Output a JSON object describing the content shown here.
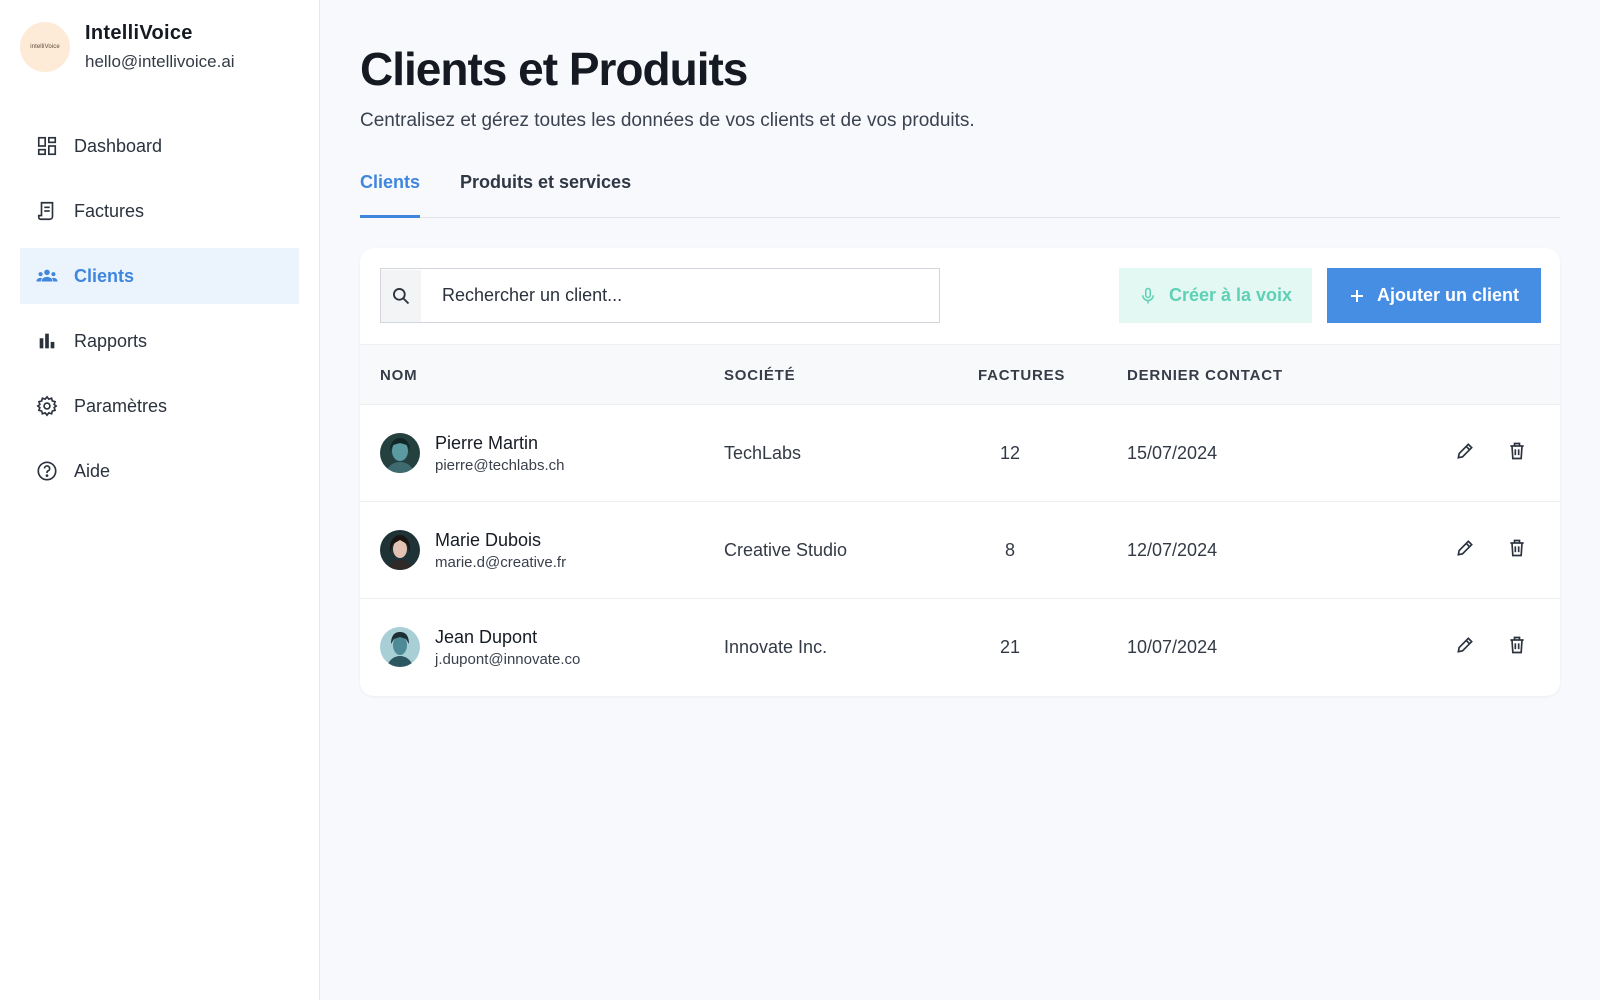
{
  "brand": {
    "name": "IntelliVoice",
    "email": "hello@intellivoice.ai",
    "logo_text": "intelliVoice"
  },
  "sidebar": {
    "items": [
      {
        "label": "Dashboard",
        "icon": "dashboard-icon",
        "active": false
      },
      {
        "label": "Factures",
        "icon": "invoice-icon",
        "active": false
      },
      {
        "label": "Clients",
        "icon": "people-icon",
        "active": true
      },
      {
        "label": "Rapports",
        "icon": "bar-chart-icon",
        "active": false
      },
      {
        "label": "Paramètres",
        "icon": "gear-icon",
        "active": false
      },
      {
        "label": "Aide",
        "icon": "help-icon",
        "active": false
      }
    ]
  },
  "page": {
    "title": "Clients et Produits",
    "subtitle": "Centralisez et gérez toutes les données de vos clients et de vos produits."
  },
  "tabs": [
    {
      "label": "Clients",
      "active": true
    },
    {
      "label": "Produits et services",
      "active": false
    }
  ],
  "toolbar": {
    "search_placeholder": "Rechercher un client...",
    "voice_label": "Créer à la voix",
    "add_label": "Ajouter un client"
  },
  "table": {
    "headers": [
      "NOM",
      "SOCIÉTÉ",
      "FACTURES",
      "DERNIER CONTACT"
    ],
    "rows": [
      {
        "name": "Pierre Martin",
        "email": "pierre@techlabs.ch",
        "company": "TechLabs",
        "invoices": "12",
        "last_contact": "15/07/2024"
      },
      {
        "name": "Marie Dubois",
        "email": "marie.d@creative.fr",
        "company": "Creative Studio",
        "invoices": "8",
        "last_contact": "12/07/2024"
      },
      {
        "name": "Jean Dupont",
        "email": "j.dupont@innovate.co",
        "company": "Innovate Inc.",
        "invoices": "21",
        "last_contact": "10/07/2024"
      }
    ]
  },
  "colors": {
    "accent": "#3f86dc",
    "accent_bg": "#ebf3fc",
    "voice_bg": "#e3f8f3",
    "voice_fg": "#5fd0b5",
    "add_bg": "#468ee3"
  }
}
